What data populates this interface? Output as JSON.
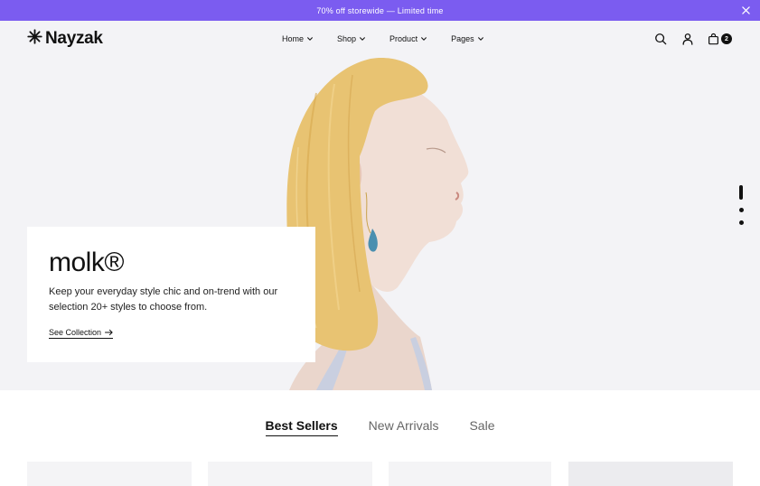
{
  "announcement": {
    "text": "70% off storewide — Limited time"
  },
  "header": {
    "logo_text": "Nayzak",
    "nav": [
      {
        "label": "Home"
      },
      {
        "label": "Shop"
      },
      {
        "label": "Product"
      },
      {
        "label": "Pages"
      }
    ],
    "cart_count": "2"
  },
  "hero": {
    "title": "molk®",
    "description": "Keep your everyday style chic and on-trend with our selection 20+ styles to choose from.",
    "link_label": "See Collection",
    "slide_count": 3,
    "active_slide": 1
  },
  "tabs": [
    {
      "label": "Best Sellers",
      "active": true
    },
    {
      "label": "New Arrivals",
      "active": false
    },
    {
      "label": "Sale",
      "active": false
    }
  ],
  "colors": {
    "announcement_bg": "#7b5cf0",
    "hero_bg": "#f3f3f6",
    "text": "#111111"
  }
}
